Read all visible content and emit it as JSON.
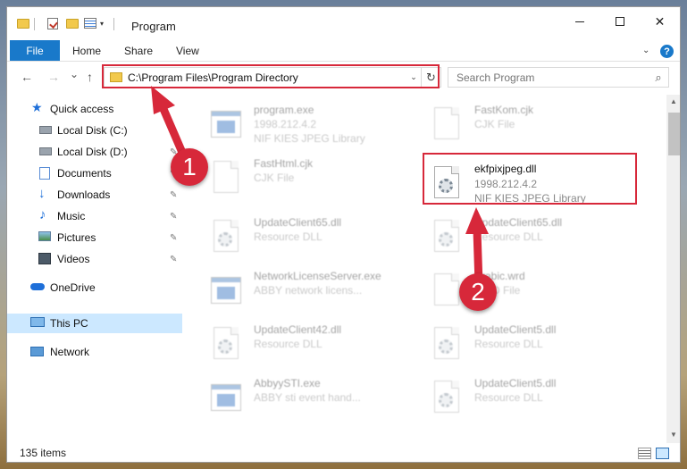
{
  "window": {
    "title": "Program",
    "controls": {
      "minimize": "minimize",
      "maximize": "maximize",
      "close": "✕"
    }
  },
  "ribbon": {
    "tabs": [
      "File",
      "Home",
      "Share",
      "View"
    ],
    "help": "?"
  },
  "nav": {
    "back": "←",
    "forward": "→",
    "recent": "⌄",
    "up": "↑",
    "address": "C:\\Program Files\\Program Directory",
    "search_placeholder": "Search Program"
  },
  "sidebar": {
    "items": [
      {
        "label": "Quick access",
        "icon": "star-icon",
        "pinned": false
      },
      {
        "label": "Local Disk (C:)",
        "icon": "drive-icon",
        "pinned": true
      },
      {
        "label": "Local Disk (D:)",
        "icon": "drive-icon",
        "pinned": true
      },
      {
        "label": "Documents",
        "icon": "documents-icon",
        "pinned": true
      },
      {
        "label": "Downloads",
        "icon": "download-icon",
        "pinned": true
      },
      {
        "label": "Music",
        "icon": "music-icon",
        "pinned": true
      },
      {
        "label": "Pictures",
        "icon": "pictures-icon",
        "pinned": true
      },
      {
        "label": "Videos",
        "icon": "videos-icon",
        "pinned": true
      },
      {
        "label": "OneDrive",
        "icon": "cloud-icon",
        "pinned": false
      },
      {
        "label": "This PC",
        "icon": "computer-icon",
        "pinned": false,
        "selected": true
      },
      {
        "label": "Network",
        "icon": "network-icon",
        "pinned": false
      }
    ]
  },
  "files": [
    {
      "name": "program.exe",
      "line2": "1998.212.4.2",
      "line3": "NIF KIES JPEG Library",
      "icon": "exe-icon"
    },
    {
      "name": "FastKom.cjk",
      "line2": "CJK File",
      "line3": "",
      "icon": "file-icon"
    },
    {
      "name": "FastHtml.cjk",
      "line2": "CJK File",
      "line3": "",
      "icon": "file-icon"
    },
    {
      "name": "ekfpixjpeg.dll",
      "line2": "1998.212.4.2",
      "line3": "NIF KIES JPEG Library",
      "icon": "dll-icon",
      "highlighted": true
    },
    {
      "name": "UpdateClient65.dll",
      "line2": "Resource DLL",
      "line3": "",
      "icon": "dll-icon"
    },
    {
      "name": "UpdateClient65.dll",
      "line2": "Resource DLL",
      "line3": "",
      "icon": "dll-icon"
    },
    {
      "name": "NetworkLicenseServer.exe",
      "line2": "ABBY network licens...",
      "line3": "",
      "icon": "exe-icon"
    },
    {
      "name": "Arabic.wrd",
      "line2": "WRD File",
      "line3": "",
      "icon": "file-icon"
    },
    {
      "name": "UpdateClient42.dll",
      "line2": "Resource DLL",
      "line3": "",
      "icon": "dll-icon"
    },
    {
      "name": "UpdateClient5.dll",
      "line2": "Resource DLL",
      "line3": "",
      "icon": "dll-icon"
    },
    {
      "name": "AbbyySTI.exe",
      "line2": "ABBY sti event hand...",
      "line3": "",
      "icon": "exe-icon"
    },
    {
      "name": "UpdateClient5.dll",
      "line2": "Resource DLL",
      "line3": "",
      "icon": "dll-icon"
    }
  ],
  "status": {
    "item_count": "135 items"
  },
  "annotations": {
    "badge1": "1",
    "badge2": "2",
    "color": "#d7283a"
  }
}
